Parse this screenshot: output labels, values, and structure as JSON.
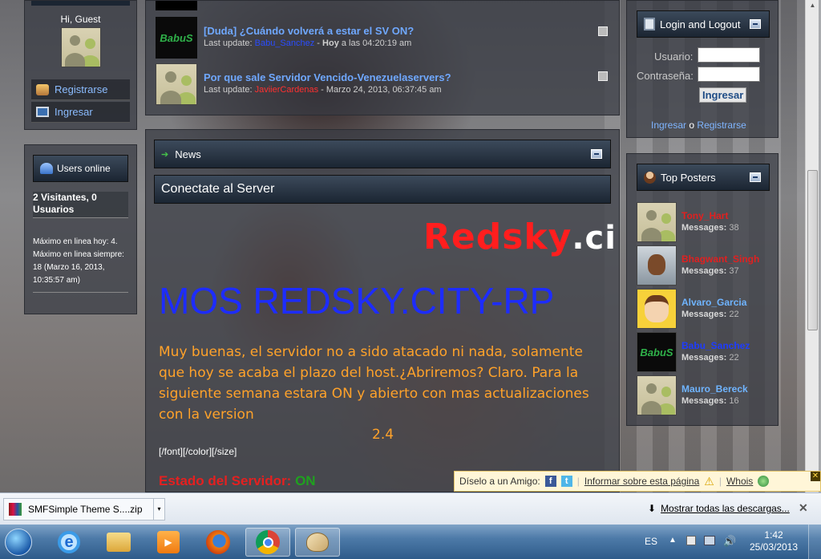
{
  "left": {
    "greeting": "Hi, Guest",
    "register": "Registrarse",
    "login": "Ingresar",
    "users_online_title": "Users online",
    "visitors": "2 Visitantes, 0 Usuarios",
    "max_today": "Máximo en linea hoy: 4.",
    "max_ever": "Máximo en linea siempre: 18 (Marzo 16, 2013, 10:35:57 am)"
  },
  "topics": [
    {
      "title": "[Duda] ¿Cuándo volverá a estar el SV ON?",
      "last_update_label": "Last update:",
      "user": "Babu_Sanchez",
      "date_sep": " - ",
      "date_bold": "Hoy",
      "date_rest": " a las 04:20:19 am"
    },
    {
      "title": "Por que sale Servidor Vencido-Venezuelaservers?",
      "last_update_label": "Last update:",
      "user": "JaviierCardenas",
      "date_sep": " - ",
      "date_bold": "",
      "date_rest": "Marzo 24, 2013, 06:37:45 am"
    }
  ],
  "news": {
    "header": "News",
    "subheader": "Conectate al Server",
    "logo_text": "Redsky",
    "logo_tld": ".ci",
    "marquee": "MOS REDSKY.CITY-RP",
    "body": "Muy buenas, el servidor no a sido atacado ni nada, solamente que hoy se acaba el plazo del host.¿Abriremos? Claro. Para la siguiente semana estara ON y abierto con mas actualizaciones con la version",
    "version": "2.4",
    "bbcode": "[/font][/color][/size]",
    "status_label": "Estado del Servidor:",
    "status_value": "ON"
  },
  "login_box": {
    "title": "Login and Logout",
    "user_label": "Usuario:",
    "pass_label": "Contraseña:",
    "submit": "Ingresar",
    "link_login": "Ingresar",
    "link_or": "o",
    "link_register": "Registrarse"
  },
  "top_posters": {
    "title": "Top Posters",
    "messages_label": "Messages:",
    "items": [
      {
        "name": "Tony_Hart",
        "count": "38",
        "color": "#e02020"
      },
      {
        "name": "Bhagwant_Singh",
        "count": "37",
        "color": "#e02020"
      },
      {
        "name": "Alvaro_Garcia",
        "count": "22",
        "color": "#6fb4ff"
      },
      {
        "name": "Babu_Sanchez",
        "count": "22",
        "color": "#1e3cff"
      },
      {
        "name": "Mauro_Bereck",
        "count": "16",
        "color": "#6fb4ff"
      }
    ]
  },
  "sharebar": {
    "tell_friend": "Díselo a un Amigo:",
    "report": "Informar sobre esta página",
    "whois": "Whois"
  },
  "downloads": {
    "file": "SMFSimple Theme S....zip",
    "show_all": "Mostrar todas las descargas..."
  },
  "taskbar": {
    "lang": "ES",
    "time": "1:42",
    "date": "25/03/2013"
  }
}
